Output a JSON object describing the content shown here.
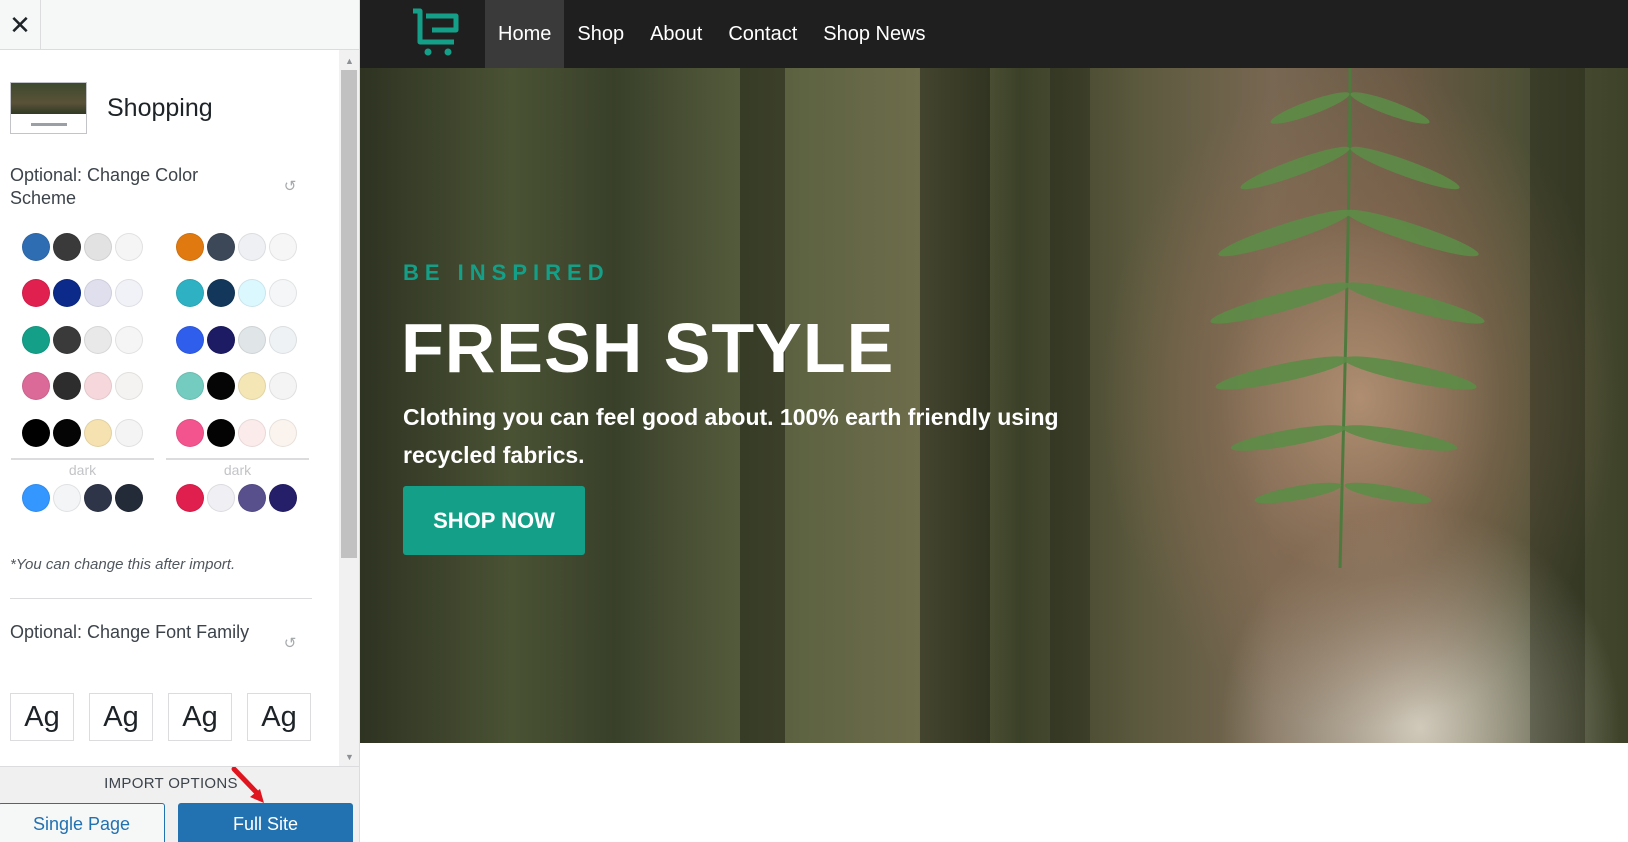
{
  "sidebar": {
    "close_glyph": "✕",
    "site": {
      "name": "Shopping"
    },
    "color_section": {
      "title": "Optional: Change Color Scheme",
      "palettes_left": [
        [
          "#2f6db3",
          "#3a3a3a",
          "#e2e2e2",
          "#f5f5f5"
        ],
        [
          "#e0204f",
          "#0b2a8a",
          "#dfdfee",
          "#f1f1f8"
        ],
        [
          "#14a088",
          "#3a3a3a",
          "#e9e9e9",
          "#f5f5f5"
        ],
        [
          "#db6a98",
          "#2d2d2d",
          "#f6d8dc",
          "#f5f3f1"
        ],
        [
          "#000000",
          "#050505",
          "#f5e2b0",
          "#f4f4f4"
        ]
      ],
      "palettes_right": [
        [
          "#e07a10",
          "#3c4857",
          "#eef0f3",
          "#f6f6f6"
        ],
        [
          "#2fb1c4",
          "#12375a",
          "#dcf8ff",
          "#f4f6f8"
        ],
        [
          "#2f5eec",
          "#1c1b63",
          "#e0e5e8",
          "#eef2f5"
        ],
        [
          "#73ccbf",
          "#050505",
          "#f5e6b5",
          "#f4f4f4"
        ],
        [
          "#f4548e",
          "#030303",
          "#fcebeb",
          "#fbf4ee"
        ]
      ],
      "dark_label": "dark",
      "dark_left": [
        "#3397ff",
        "#f4f5f7",
        "#2e3548",
        "#232a38"
      ],
      "dark_right": [
        "#e01f4e",
        "#efeff4",
        "#58508d",
        "#251f6a"
      ],
      "note": "*You can change this after import."
    },
    "font_section": {
      "title": "Optional: Change Font Family",
      "samples": [
        "Ag",
        "Ag",
        "Ag",
        "Ag"
      ]
    },
    "import": {
      "label": "IMPORT OPTIONS",
      "single_page": "Single Page",
      "full_site": "Full Site"
    }
  },
  "preview": {
    "nav": [
      "Home",
      "Shop",
      "About",
      "Contact",
      "Shop News"
    ],
    "active_nav": "Home",
    "hero": {
      "eyebrow": "BE INSPIRED",
      "title": "FRESH STYLE",
      "subtitle": "Clothing you can feel good about. 100% earth friendly using recycled fabrics.",
      "button": "SHOP NOW"
    },
    "colors": {
      "accent": "#14a088",
      "nav_bg": "#1f1f1f",
      "button_blue": "#2271b1"
    }
  }
}
